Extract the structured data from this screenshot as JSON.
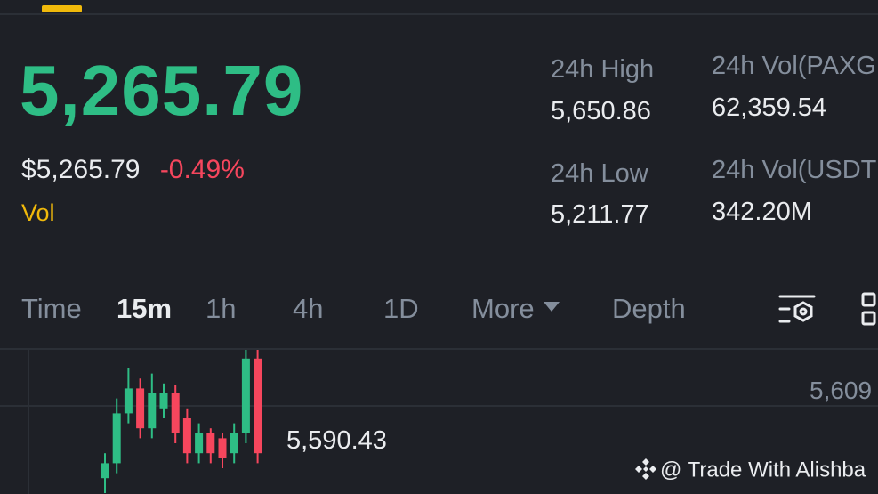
{
  "ticker": {
    "last_price": "5,265.79",
    "usd_price": "$5,265.79",
    "change_pct": "-0.49%",
    "vol_label": "Vol"
  },
  "stats": {
    "high_label": "24h High",
    "high_value": "5,650.86",
    "low_label": "24h Low",
    "low_value": "5,211.77",
    "vol_base_label": "24h Vol(PAXG",
    "vol_base_value": "62,359.54",
    "vol_quote_label": "24h Vol(USDT",
    "vol_quote_value": "342.20M"
  },
  "intervals": {
    "time": "Time",
    "m15": "15m",
    "h1": "1h",
    "h4": "4h",
    "d1": "1D",
    "more": "More",
    "depth": "Depth",
    "active": "15m"
  },
  "chart": {
    "axis_top_label": "5,609",
    "high_marker": "5,590.43",
    "colors": {
      "up": "#2ebd85",
      "down": "#f6465d"
    },
    "candles": [
      {
        "dir": "up",
        "open": 5455,
        "close": 5470,
        "high": 5480,
        "low": 5440
      },
      {
        "dir": "up",
        "open": 5470,
        "close": 5520,
        "high": 5535,
        "low": 5460
      },
      {
        "dir": "up",
        "open": 5520,
        "close": 5545,
        "high": 5565,
        "low": 5510
      },
      {
        "dir": "down",
        "open": 5545,
        "close": 5505,
        "high": 5555,
        "low": 5495
      },
      {
        "dir": "up",
        "open": 5505,
        "close": 5540,
        "high": 5560,
        "low": 5495
      },
      {
        "dir": "up",
        "open": 5525,
        "close": 5540,
        "high": 5550,
        "low": 5515
      },
      {
        "dir": "down",
        "open": 5540,
        "close": 5500,
        "high": 5548,
        "low": 5490
      },
      {
        "dir": "down",
        "open": 5515,
        "close": 5480,
        "high": 5525,
        "low": 5470
      },
      {
        "dir": "up",
        "open": 5480,
        "close": 5500,
        "high": 5510,
        "low": 5470
      },
      {
        "dir": "down",
        "open": 5500,
        "close": 5480,
        "high": 5505,
        "low": 5470
      },
      {
        "dir": "down",
        "open": 5495,
        "close": 5475,
        "high": 5500,
        "low": 5465
      },
      {
        "dir": "up",
        "open": 5480,
        "close": 5500,
        "high": 5510,
        "low": 5470
      },
      {
        "dir": "up",
        "open": 5500,
        "close": 5575,
        "high": 5590,
        "low": 5490
      },
      {
        "dir": "down",
        "open": 5575,
        "close": 5480,
        "high": 5585,
        "low": 5470
      }
    ]
  },
  "watermark": "@ Trade With Alishba"
}
